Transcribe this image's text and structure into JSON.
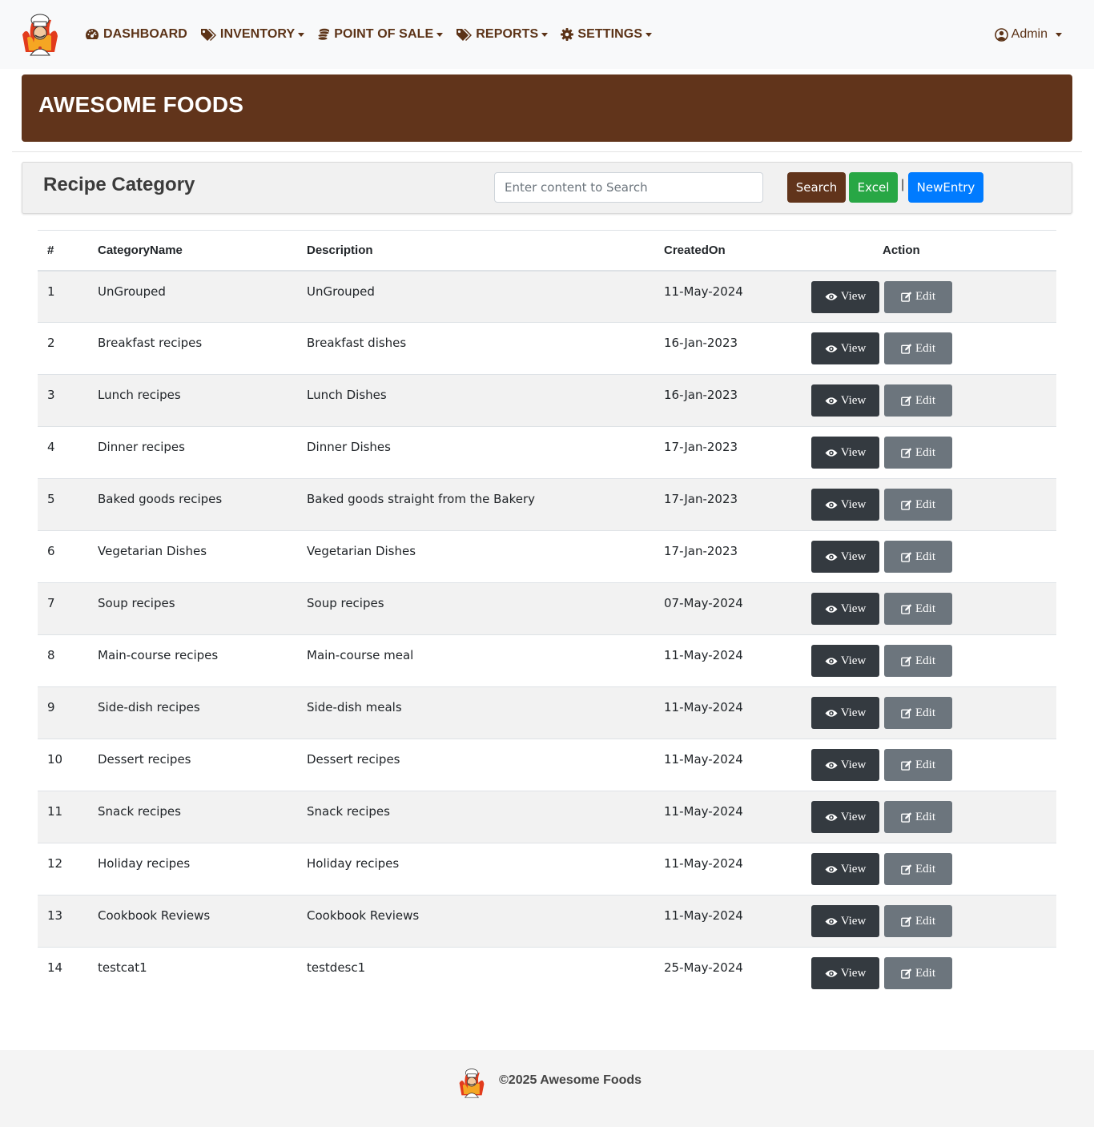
{
  "brand": {
    "logo_icon": "chef-logo-icon",
    "accent": "#61341b",
    "nav_color": "#5c3317"
  },
  "nav": {
    "items": [
      {
        "label": "DASHBOARD",
        "icon": "dashboard-gauge-icon",
        "dropdown": false
      },
      {
        "label": "INVENTORY",
        "icon": "tags-icon",
        "dropdown": true
      },
      {
        "label": "POINT OF SALE",
        "icon": "coins-icon",
        "dropdown": true
      },
      {
        "label": "REPORTS",
        "icon": "tags-icon",
        "dropdown": true
      },
      {
        "label": "SETTINGS",
        "icon": "gear-icon",
        "dropdown": true
      }
    ],
    "user": {
      "label": "Admin",
      "icon": "user-circle-icon"
    }
  },
  "banner": {
    "title": "AWESOME FOODS"
  },
  "toolbar": {
    "title": "Recipe Category",
    "search_placeholder": "Enter content to Search",
    "search_label": "Search",
    "excel_label": "Excel",
    "separator": "|",
    "new_label": "NewEntry"
  },
  "table": {
    "headers": [
      "#",
      "CategoryName",
      "Description",
      "CreatedOn",
      "Action"
    ],
    "view_label": "View",
    "edit_label": "Edit",
    "rows": [
      {
        "num": "1",
        "name": "UnGrouped",
        "desc": "UnGrouped",
        "created": "11-May-2024"
      },
      {
        "num": "2",
        "name": "Breakfast recipes",
        "desc": "Breakfast dishes",
        "created": "16-Jan-2023"
      },
      {
        "num": "3",
        "name": "Lunch recipes",
        "desc": "Lunch Dishes",
        "created": "16-Jan-2023"
      },
      {
        "num": "4",
        "name": "Dinner recipes",
        "desc": "Dinner Dishes",
        "created": "17-Jan-2023"
      },
      {
        "num": "5",
        "name": "Baked goods recipes",
        "desc": "Baked goods straight from the Bakery",
        "created": "17-Jan-2023"
      },
      {
        "num": "6",
        "name": "Vegetarian Dishes",
        "desc": "Vegetarian Dishes",
        "created": "17-Jan-2023"
      },
      {
        "num": "7",
        "name": "Soup recipes",
        "desc": "Soup recipes",
        "created": "07-May-2024"
      },
      {
        "num": "8",
        "name": "Main-course recipes",
        "desc": "Main-course meal",
        "created": "11-May-2024"
      },
      {
        "num": "9",
        "name": "Side-dish recipes",
        "desc": "Side-dish meals",
        "created": "11-May-2024"
      },
      {
        "num": "10",
        "name": "Dessert recipes",
        "desc": "Dessert recipes",
        "created": "11-May-2024"
      },
      {
        "num": "11",
        "name": "Snack recipes",
        "desc": "Snack recipes",
        "created": "11-May-2024"
      },
      {
        "num": "12",
        "name": "Holiday recipes",
        "desc": "Holiday recipes",
        "created": "11-May-2024"
      },
      {
        "num": "13",
        "name": "Cookbook Reviews",
        "desc": "Cookbook Reviews",
        "created": "11-May-2024"
      },
      {
        "num": "14",
        "name": "testcat1",
        "desc": "testdesc1",
        "created": "25-May-2024"
      }
    ]
  },
  "footer": {
    "text": "©2025 Awesome Foods"
  }
}
